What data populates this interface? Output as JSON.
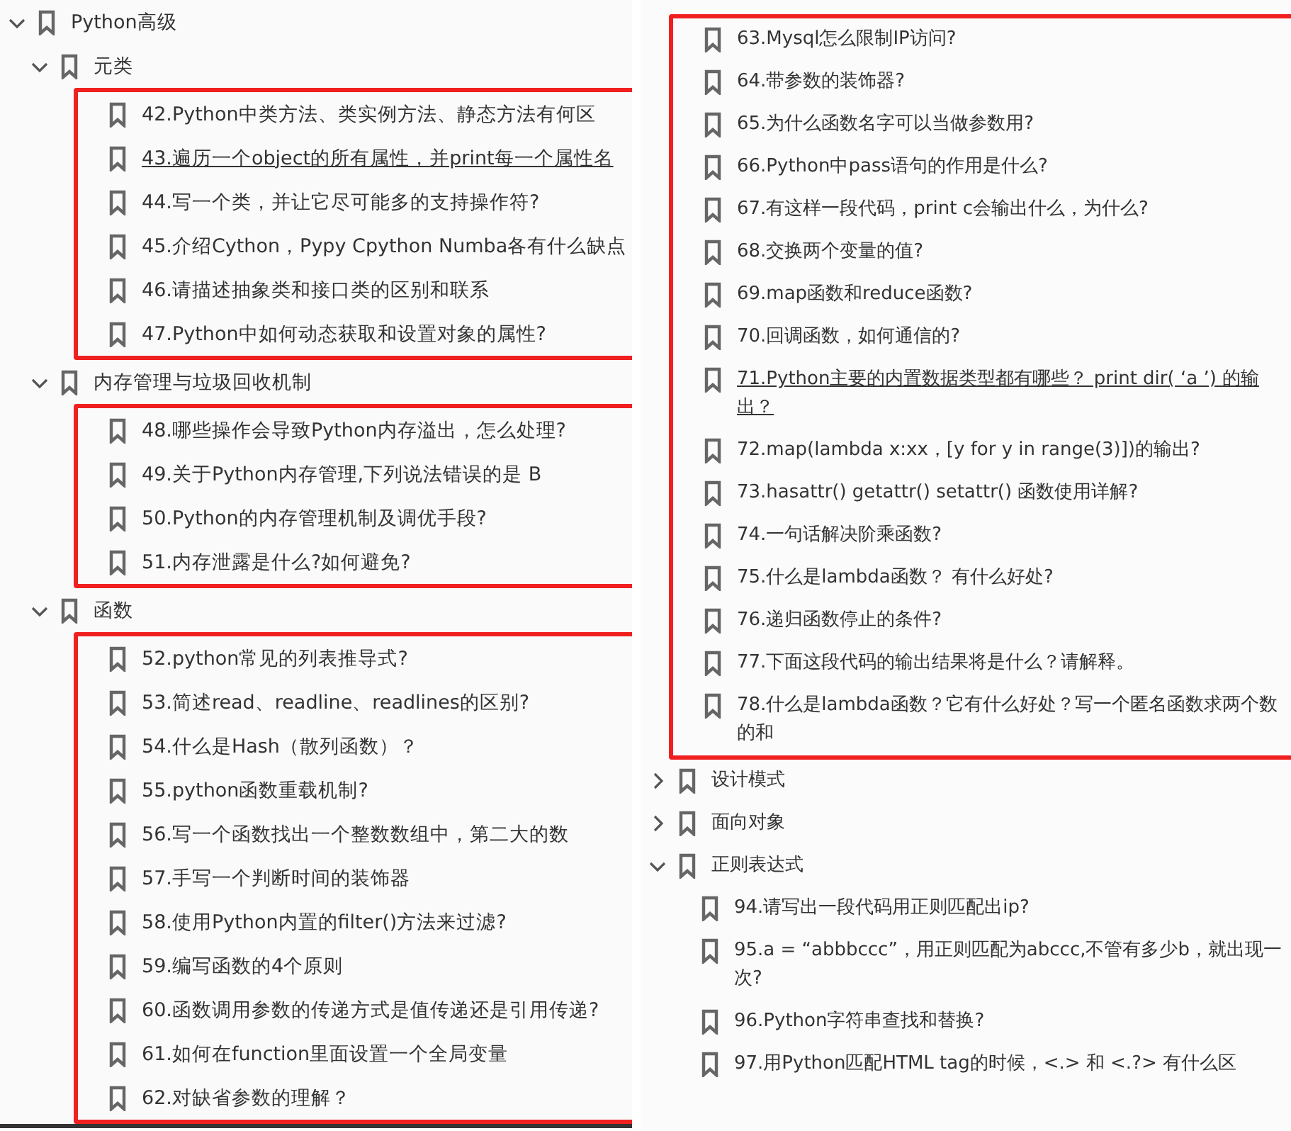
{
  "panels": [
    {
      "tree": [
        {
          "kind": "node",
          "label": "Python高级",
          "expanded": true,
          "children": [
            {
              "kind": "node",
              "label": "元类",
              "expanded": true,
              "children": [
                {
                  "kind": "group",
                  "outlined": true,
                  "children": [
                    {
                      "kind": "leaf",
                      "label": "42.Python中类方法、类实例方法、静态方法有何区",
                      "underlined": false
                    },
                    {
                      "kind": "leaf",
                      "label": "43.遍历一个object的所有属性，并print每一个属性名",
                      "underlined": true
                    },
                    {
                      "kind": "leaf",
                      "label": "44.写一个类，并让它尽可能多的支持操作符?",
                      "underlined": false
                    },
                    {
                      "kind": "leaf",
                      "label": "45.介绍Cython，Pypy Cpython Numba各有什么缺点",
                      "underlined": false
                    },
                    {
                      "kind": "leaf",
                      "label": "46.请描述抽象类和接口类的区别和联系",
                      "underlined": false
                    },
                    {
                      "kind": "leaf",
                      "label": "47.Python中如何动态获取和设置对象的属性?",
                      "underlined": false
                    }
                  ]
                }
              ]
            },
            {
              "kind": "node",
              "label": "内存管理与垃圾回收机制",
              "expanded": true,
              "children": [
                {
                  "kind": "group",
                  "outlined": true,
                  "children": [
                    {
                      "kind": "leaf",
                      "label": "48.哪些操作会导致Python内存溢出，怎么处理?",
                      "underlined": false
                    },
                    {
                      "kind": "leaf",
                      "label": "49.关于Python内存管理,下列说法错误的是  B",
                      "underlined": false
                    },
                    {
                      "kind": "leaf",
                      "label": "50.Python的内存管理机制及调优手段?",
                      "underlined": false
                    },
                    {
                      "kind": "leaf",
                      "label": "51.内存泄露是什么?如何避免?",
                      "underlined": false
                    }
                  ]
                }
              ]
            },
            {
              "kind": "node",
              "label": "函数",
              "expanded": true,
              "children": [
                {
                  "kind": "group",
                  "outlined": true,
                  "children": [
                    {
                      "kind": "leaf",
                      "label": "52.python常见的列表推导式?",
                      "underlined": false
                    },
                    {
                      "kind": "leaf",
                      "label": "53.简述read、readline、readlines的区别?",
                      "underlined": false
                    },
                    {
                      "kind": "leaf",
                      "label": "54.什么是Hash（散列函数）？",
                      "underlined": false
                    },
                    {
                      "kind": "leaf",
                      "label": "55.python函数重载机制?",
                      "underlined": false
                    },
                    {
                      "kind": "leaf",
                      "label": "56.写一个函数找出一个整数数组中，第二大的数",
                      "underlined": false
                    },
                    {
                      "kind": "leaf",
                      "label": "57.手写一个判断时间的装饰器",
                      "underlined": false
                    },
                    {
                      "kind": "leaf",
                      "label": "58.使用Python内置的filter()方法来过滤?",
                      "underlined": false
                    },
                    {
                      "kind": "leaf",
                      "label": "59.编写函数的4个原则",
                      "underlined": false
                    },
                    {
                      "kind": "leaf",
                      "label": "60.函数调用参数的传递方式是值传递还是引用传递?",
                      "underlined": false
                    },
                    {
                      "kind": "leaf",
                      "label": "61.如何在function里面设置一个全局变量",
                      "underlined": false
                    },
                    {
                      "kind": "leaf",
                      "label": "62.对缺省参数的理解？",
                      "underlined": false
                    }
                  ]
                }
              ]
            }
          ]
        }
      ]
    },
    {
      "tree": [
        {
          "kind": "group",
          "outlined": true,
          "children": [
            {
              "kind": "leaf",
              "label": "63.Mysql怎么限制IP访问?",
              "underlined": false
            },
            {
              "kind": "leaf",
              "label": "64.带参数的装饰器?",
              "underlined": false
            },
            {
              "kind": "leaf",
              "label": "65.为什么函数名字可以当做参数用?",
              "underlined": false
            },
            {
              "kind": "leaf",
              "label": "66.Python中pass语句的作用是什么?",
              "underlined": false
            },
            {
              "kind": "leaf",
              "label": "67.有这样一段代码，print c会输出什么，为什么?",
              "underlined": false
            },
            {
              "kind": "leaf",
              "label": "68.交换两个变量的值?",
              "underlined": false
            },
            {
              "kind": "leaf",
              "label": "69.map函数和reduce函数?",
              "underlined": false
            },
            {
              "kind": "leaf",
              "label": "70.回调函数，如何通信的?",
              "underlined": false
            },
            {
              "kind": "leaf",
              "label": "71.Python主要的内置数据类型都有哪些？ print dir( ‘a ’) 的输出？",
              "underlined": true
            },
            {
              "kind": "leaf",
              "label": "72.map(lambda x:xx，[y for y in range(3)])的输出?",
              "underlined": false
            },
            {
              "kind": "leaf",
              "label": "73.hasattr() getattr() setattr() 函数使用详解?",
              "underlined": false
            },
            {
              "kind": "leaf",
              "label": "74.一句话解决阶乘函数?",
              "underlined": false
            },
            {
              "kind": "leaf",
              "label": "75.什么是lambda函数？ 有什么好处?",
              "underlined": false
            },
            {
              "kind": "leaf",
              "label": "76.递归函数停止的条件?",
              "underlined": false
            },
            {
              "kind": "leaf",
              "label": "77.下面这段代码的输出结果将是什么？请解释。",
              "underlined": false
            },
            {
              "kind": "leaf",
              "label": "78.什么是lambda函数？它有什么好处？写一个匿名函数求两个数的和",
              "underlined": false
            }
          ]
        },
        {
          "kind": "node",
          "label": "设计模式",
          "expanded": false
        },
        {
          "kind": "node",
          "label": "面向对象",
          "expanded": false
        },
        {
          "kind": "node",
          "label": "正则表达式",
          "expanded": true,
          "children": [
            {
              "kind": "leaf",
              "label": "94.请写出一段代码用正则匹配出ip?",
              "underlined": false
            },
            {
              "kind": "leaf",
              "label": "95.a = “abbbccc”，用正则匹配为abccc,不管有多少b，就出现一次?",
              "underlined": false
            },
            {
              "kind": "leaf",
              "label": "96.Python字符串查找和替换?",
              "underlined": false
            },
            {
              "kind": "leaf",
              "label": "97.用Python匹配HTML tag的时候，<.> 和 <.?> 有什么区",
              "underlined": false
            }
          ]
        }
      ]
    }
  ]
}
